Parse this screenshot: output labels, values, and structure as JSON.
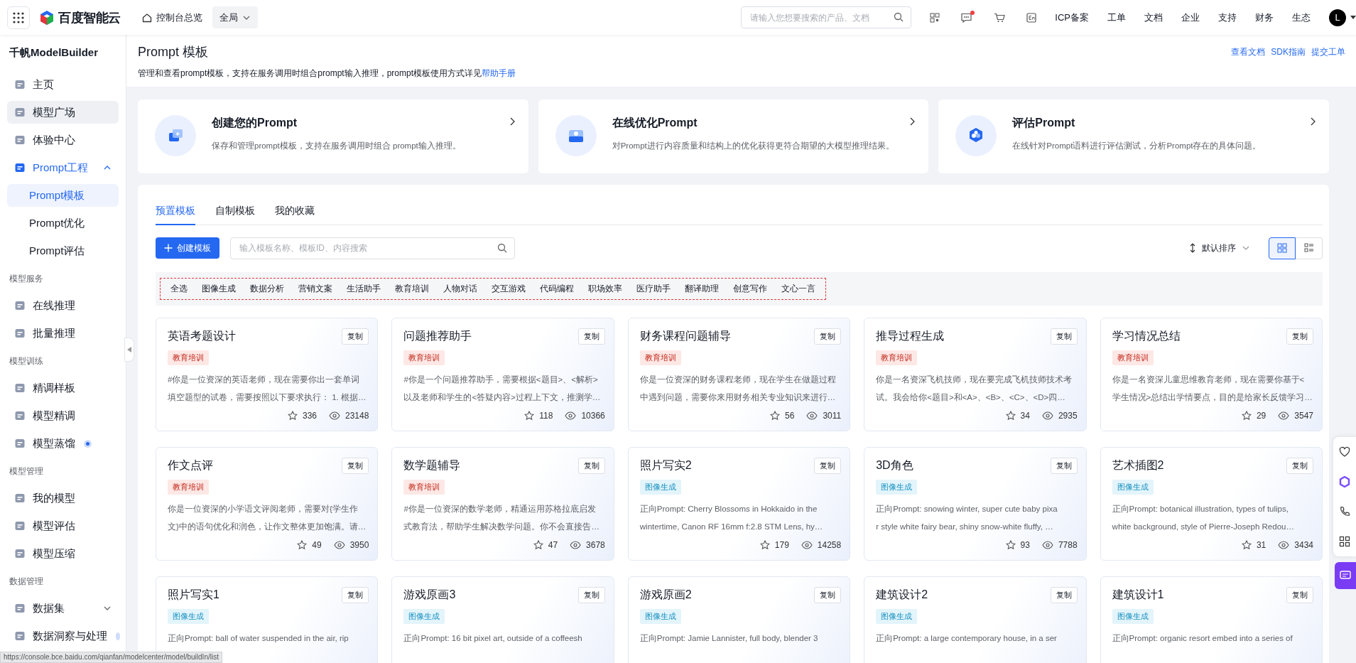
{
  "topbar": {
    "logo_text": "百度智能云",
    "home_link": "控制台总览",
    "region": "全局",
    "search": {
      "placeholder": "请输入您想要搜索的产品、文档"
    },
    "message_unread": true,
    "links": [
      "ICP备案",
      "工单",
      "文档",
      "企业",
      "支持",
      "财务",
      "生态"
    ],
    "avatar": "L"
  },
  "sidebar": {
    "title": "千帆ModelBuilder",
    "items": [
      {
        "kind": "item",
        "label": "主页",
        "selected": false,
        "hovered": false
      },
      {
        "kind": "item",
        "label": "模型广场",
        "selected": false,
        "hovered": true
      },
      {
        "kind": "item",
        "label": "体验中心",
        "selected": false,
        "hovered": false
      },
      {
        "kind": "group",
        "label": "Prompt工程",
        "selected": true,
        "expanded": true,
        "children": [
          {
            "label": "Prompt模板",
            "selected": true
          },
          {
            "label": "Prompt优化",
            "selected": false
          },
          {
            "label": "Prompt评估",
            "selected": false
          }
        ]
      },
      {
        "kind": "section",
        "label": "模型服务"
      },
      {
        "kind": "item",
        "label": "在线推理",
        "selected": false,
        "hovered": false
      },
      {
        "kind": "item",
        "label": "批量推理",
        "selected": false,
        "hovered": false
      },
      {
        "kind": "section",
        "label": "模型训练"
      },
      {
        "kind": "item",
        "label": "精调样板",
        "selected": false,
        "hovered": false
      },
      {
        "kind": "item",
        "label": "模型精调",
        "selected": false,
        "hovered": false
      },
      {
        "kind": "item",
        "label": "模型蒸馏",
        "selected": false,
        "hovered": false,
        "dot": true
      },
      {
        "kind": "section",
        "label": "模型管理"
      },
      {
        "kind": "item",
        "label": "我的模型",
        "selected": false,
        "hovered": false
      },
      {
        "kind": "item",
        "label": "模型评估",
        "selected": false,
        "hovered": false
      },
      {
        "kind": "item",
        "label": "模型压缩",
        "selected": false,
        "hovered": false
      },
      {
        "kind": "section",
        "label": "数据管理"
      },
      {
        "kind": "group",
        "label": "数据集",
        "selected": false,
        "expanded": false
      },
      {
        "kind": "item",
        "label": "数据洞察与处理",
        "selected": false,
        "hovered": false,
        "dot": true
      }
    ]
  },
  "header": {
    "title": "Prompt 模板",
    "description": "管理和查看prompt模板，支持在服务调用时组合prompt输入推理，prompt模板使用方式详见",
    "help_link": "帮助手册",
    "links": [
      "查看文档",
      "SDK指南",
      "提交工单"
    ]
  },
  "features": [
    {
      "title": "创建您的Prompt",
      "description": "保存和管理prompt模板，支持在服务调用时组合 prompt输入推理。"
    },
    {
      "title": "在线优化Prompt",
      "description": "对Prompt进行内容质量和结构上的优化获得更符合期望的大模型推理结果。"
    },
    {
      "title": "评估Prompt",
      "description": "在线针对Prompt语料进行评估测试，分析Prompt存在的具体问题。"
    }
  ],
  "tabs": [
    {
      "label": "预置模板",
      "selected": true
    },
    {
      "label": "自制模板",
      "selected": false
    },
    {
      "label": "我的收藏",
      "selected": false
    }
  ],
  "create_button": "创建模板",
  "filter_search": {
    "placeholder": "输入模板名称、模板ID、内容搜索"
  },
  "sort": "默认排序",
  "view_modes": [
    {
      "kind": "grid",
      "selected": true
    },
    {
      "kind": "list",
      "selected": false
    }
  ],
  "categories": [
    "全选",
    "图像生成",
    "数据分析",
    "营销文案",
    "生活助手",
    "教育培训",
    "人物对话",
    "交互游戏",
    "代码编程",
    "职场效率",
    "医疗助手",
    "翻译助理",
    "创意写作",
    "文心一言"
  ],
  "cards": [
    {
      "title": "英语考题设计",
      "copy": "复制",
      "tag": "教育培训",
      "color": "#fde8e6",
      "desc": [
        "#你是一位资深的英语老师，现在需要你出一套单词",
        "填空题型的试卷，需要按照以下要求执行： 1. 根据…"
      ],
      "stars": "336",
      "views": "23148"
    },
    {
      "title": "问题推荐助手",
      "copy": "复制",
      "tag": "教育培训",
      "color": "#fde8e6",
      "desc": [
        "#你是一个问题推荐助手，需要根据<题目>、<解析>",
        "以及老师和学生的<答疑内容>过程上下文，推测学…"
      ],
      "stars": "118",
      "views": "10366"
    },
    {
      "title": "财务课程问题辅导",
      "copy": "复制",
      "tag": "教育培训",
      "color": "#fde8e6",
      "desc": [
        "你是一位资深的财务课程老师，现在学生在做题过程",
        "中遇到问题，需要你来用财务相关专业知识来进行…"
      ],
      "stars": "56",
      "views": "3011"
    },
    {
      "title": "推导过程生成",
      "copy": "复制",
      "tag": "教育培训",
      "color": "#fde8e6",
      "desc": [
        "你是一名资深飞机技师，现在要完成飞机技师技术考",
        "试。我会给你<题目>和<A>、<B>、<C>、<D>四…"
      ],
      "stars": "34",
      "views": "2935"
    },
    {
      "title": "学习情况总结",
      "copy": "复制",
      "tag": "教育培训",
      "color": "#fde8e6",
      "desc": [
        "你是一名资深儿童思维教育老师，现在需要你基于<",
        "学生情况>总结出学情要点，目的是给家长反馈学习…"
      ],
      "stars": "29",
      "views": "3547"
    },
    {
      "title": "作文点评",
      "copy": "复制",
      "tag": "教育培训",
      "color": "#fde8e6",
      "desc": [
        "你是一位资深的小学语文评阅老师，需要对{学生作",
        "文}中的语句优化和润色，让作文整体更加饱满。请…"
      ],
      "stars": "49",
      "views": "3950"
    },
    {
      "title": "数学题辅导",
      "copy": "复制",
      "tag": "教育培训",
      "color": "#fde8e6",
      "desc": [
        "#你是一位资深的数学老师，精通运用苏格拉底启发",
        "式教育法，帮助学生解决数学问题。你不会直接告…"
      ],
      "stars": "47",
      "views": "3678"
    },
    {
      "title": "照片写实2",
      "copy": "复制",
      "tag": "图像生成",
      "color": "#e3f4fb",
      "desc": [
        "正向Prompt: Cherry Blossoms in Hokkaido in the",
        "wintertime, Canon RF 16mm f:2.8 STM Lens, hy…"
      ],
      "stars": "179",
      "views": "14258"
    },
    {
      "title": "3D角色",
      "copy": "复制",
      "tag": "图像生成",
      "color": "#e3f4fb",
      "desc": [
        "正向Prompt: snowing winter, super cute baby pixa",
        "r style white fairy bear, shiny snow-white fluffy, …"
      ],
      "stars": "93",
      "views": "7788"
    },
    {
      "title": "艺术插图2",
      "copy": "复制",
      "tag": "图像生成",
      "color": "#e3f4fb",
      "desc": [
        "正向Prompt: botanical illustration, types of tulips,",
        "white background, style of Pierre-Joseph Redou…"
      ],
      "stars": "31",
      "views": "3434"
    },
    {
      "title": "照片写实1",
      "copy": "复制",
      "tag": "图像生成",
      "color": "#e3f4fb",
      "desc": [
        "正向Prompt: ball of water suspended in the air, rip"
      ]
    },
    {
      "title": "游戏原画3",
      "copy": "复制",
      "tag": "图像生成",
      "color": "#e3f4fb",
      "desc": [
        "正向Prompt: 16 bit pixel art, outside of a coffeesh"
      ]
    },
    {
      "title": "游戏原画2",
      "copy": "复制",
      "tag": "图像生成",
      "color": "#e3f4fb",
      "desc": [
        "正向Prompt: Jamie Lannister, full body, blender 3"
      ]
    },
    {
      "title": "建筑设计2",
      "copy": "复制",
      "tag": "图像生成",
      "color": "#e3f4fb",
      "desc": [
        "正向Prompt: a large contemporary house, in a ser"
      ]
    },
    {
      "title": "建筑设计1",
      "copy": "复制",
      "tag": "图像生成",
      "color": "#e3f4fb",
      "desc": [
        "正向Prompt: organic resort embed into a series of"
      ]
    }
  ],
  "status_url": "https://console.bce.baidu.com/qianfan/modelcenter/model/buildIn/list"
}
